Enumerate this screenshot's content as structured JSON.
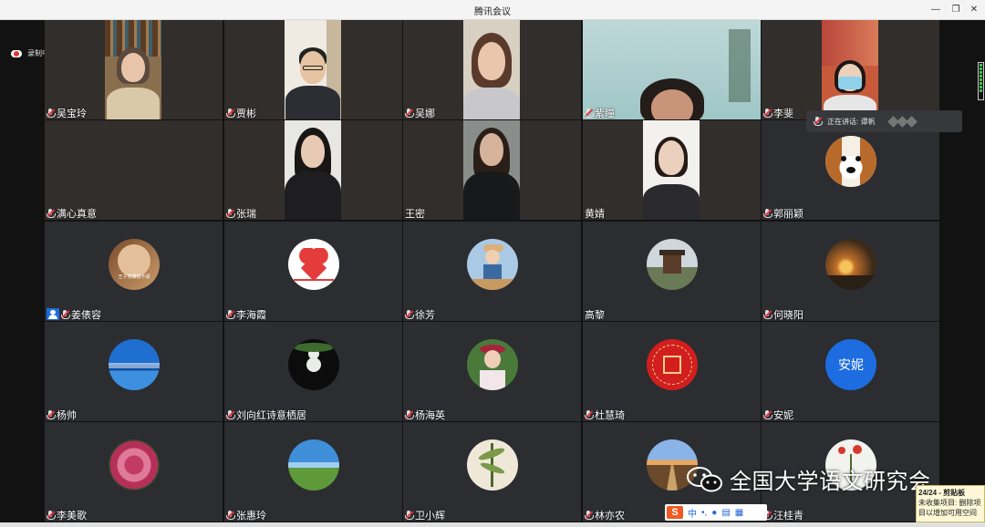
{
  "window": {
    "title": "腾讯会议",
    "controls": [
      "minimize",
      "restore",
      "close"
    ]
  },
  "recording": {
    "label": "录制中"
  },
  "participants": [
    {
      "name": "吴宝玲",
      "mic": "off"
    },
    {
      "name": "贾彬",
      "mic": "off"
    },
    {
      "name": "吴娜",
      "mic": "off"
    },
    {
      "name": "紫瞳",
      "mic": "off"
    },
    {
      "name": "李斐",
      "mic": "off"
    },
    {
      "name": "满心真意",
      "mic": "off"
    },
    {
      "name": "张瑞",
      "mic": "off"
    },
    {
      "name": "王密",
      "mic": "none"
    },
    {
      "name": "黄婧",
      "mic": "none"
    },
    {
      "name": "郭丽颖",
      "mic": "off"
    },
    {
      "name": "姜俵容",
      "mic": "off",
      "host_badge": true,
      "avatar_caption": "王子党傅撰不顽"
    },
    {
      "name": "李海霞",
      "mic": "off"
    },
    {
      "name": "徐芳",
      "mic": "off"
    },
    {
      "name": "高黎",
      "mic": "none"
    },
    {
      "name": "何晓阳",
      "mic": "off"
    },
    {
      "name": "杨帅",
      "mic": "off"
    },
    {
      "name": "刘向红诗意栖居",
      "mic": "off"
    },
    {
      "name": "杨海英",
      "mic": "off"
    },
    {
      "name": "杜慧琦",
      "mic": "off"
    },
    {
      "name": "安妮",
      "mic": "off",
      "avatar_text": "安妮"
    },
    {
      "name": "李美歌",
      "mic": "off"
    },
    {
      "name": "张惠玲",
      "mic": "off"
    },
    {
      "name": "卫小辉",
      "mic": "off"
    },
    {
      "name": "林亦农",
      "mic": "off"
    },
    {
      "name": "汪桂青",
      "mic": "off"
    }
  ],
  "speaking": {
    "label": "正在讲话: 谭帆"
  },
  "watermark": {
    "text": "全国大学语文研究会"
  },
  "ime": {
    "logo": "S",
    "mode": "中",
    "punct": "•,"
  },
  "clipboard": {
    "title": "24/24 - 剪贴板",
    "line1": "未收集项目: 删除项",
    "line2": "目以增加可用空间"
  },
  "colors": {
    "tile_bg": "#2b2d31",
    "accent_blue": "#1d6ce0",
    "record_red": "#e0353a"
  }
}
